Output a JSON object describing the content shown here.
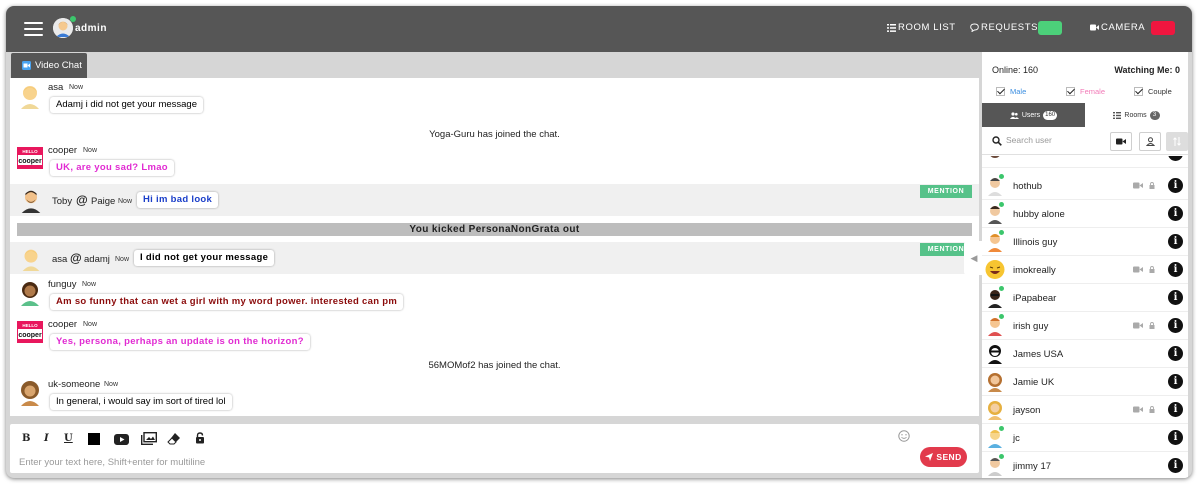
{
  "header": {
    "menu_icon": "hamburger-icon",
    "username": "admin",
    "room_list_label": "ROOM LIST",
    "requests_label": "REQUESTS",
    "camera_label": "CAMERA",
    "requests_toggle_color": "#4cd07a",
    "camera_toggle_color": "#f0163f"
  },
  "tabs": [
    {
      "label": "Video Chat",
      "icon": "video-chat-icon"
    }
  ],
  "messages": [
    {
      "type": "msg",
      "user": "asa",
      "time": "Now",
      "text": "Adamj i did not get your message",
      "color": "#222222"
    },
    {
      "type": "system",
      "text": "Yoga-Guru has joined the chat."
    },
    {
      "type": "msg",
      "user": "cooper",
      "time": "Now",
      "text": "UK, are you sad? Lmao",
      "color": "#e12bd2"
    },
    {
      "type": "mention",
      "user": "Toby",
      "to": "Paige",
      "time": "Now",
      "text": "Hi im bad look",
      "color": "#1a3ec9",
      "badge": "MENTION"
    },
    {
      "type": "kick",
      "text": "You kicked PersonaNonGrata out"
    },
    {
      "type": "mention",
      "user": "asa",
      "to": "adamj",
      "time": "Now",
      "text": "I did not get your message",
      "color": "#222222",
      "badge": "MENTION"
    },
    {
      "type": "msg",
      "user": "funguy",
      "time": "Now",
      "text": "Am so funny that can wet a girl with my word power. interested can pm",
      "color": "#8b0b0b"
    },
    {
      "type": "msg",
      "user": "cooper",
      "time": "Now",
      "text": "Yes, persona, perhaps an update is on the horizon?",
      "color": "#e12bd2"
    },
    {
      "type": "system",
      "text": "56MOMof2 has joined the chat."
    },
    {
      "type": "msg",
      "user": "uk-someone",
      "time": "Now",
      "text": "In general, i would say im sort of tired lol",
      "color": "#222222"
    }
  ],
  "composer": {
    "placeholder": "Enter your text here, Shift+enter for multiline",
    "tools": [
      "bold-icon",
      "italic-icon",
      "underline-icon",
      "color-swatch-icon",
      "youtube-icon",
      "image-icon",
      "eraser-icon",
      "lock-icon"
    ],
    "bold": "B",
    "italic": "I",
    "underline": "U",
    "send_label": "SEND",
    "emoji_icon": "smiley-icon"
  },
  "sidebar": {
    "online_label": "Online: 160",
    "watching_label": "Watching Me: 0",
    "filters": [
      {
        "label": "Male",
        "color": "#3a8de0"
      },
      {
        "label": "Female",
        "color": "#f27ab7"
      },
      {
        "label": "Couple",
        "color": "#333333"
      }
    ],
    "tabs": [
      {
        "label": "Users",
        "count": "160",
        "active": true
      },
      {
        "label": "Rooms",
        "count": "3",
        "active": false
      }
    ],
    "search_placeholder": "Search user",
    "users": [
      {
        "name": "hothub",
        "cam": true
      },
      {
        "name": "hubby alone",
        "cam": false
      },
      {
        "name": "Illinois guy",
        "cam": false
      },
      {
        "name": "imokreally",
        "cam": true
      },
      {
        "name": "iPapabear",
        "cam": false
      },
      {
        "name": "irish guy",
        "cam": true
      },
      {
        "name": "James USA",
        "cam": false
      },
      {
        "name": "Jamie UK",
        "cam": false
      },
      {
        "name": "jayson",
        "cam": true
      },
      {
        "name": "jc",
        "cam": false
      },
      {
        "name": "jimmy 17",
        "cam": false
      }
    ]
  }
}
